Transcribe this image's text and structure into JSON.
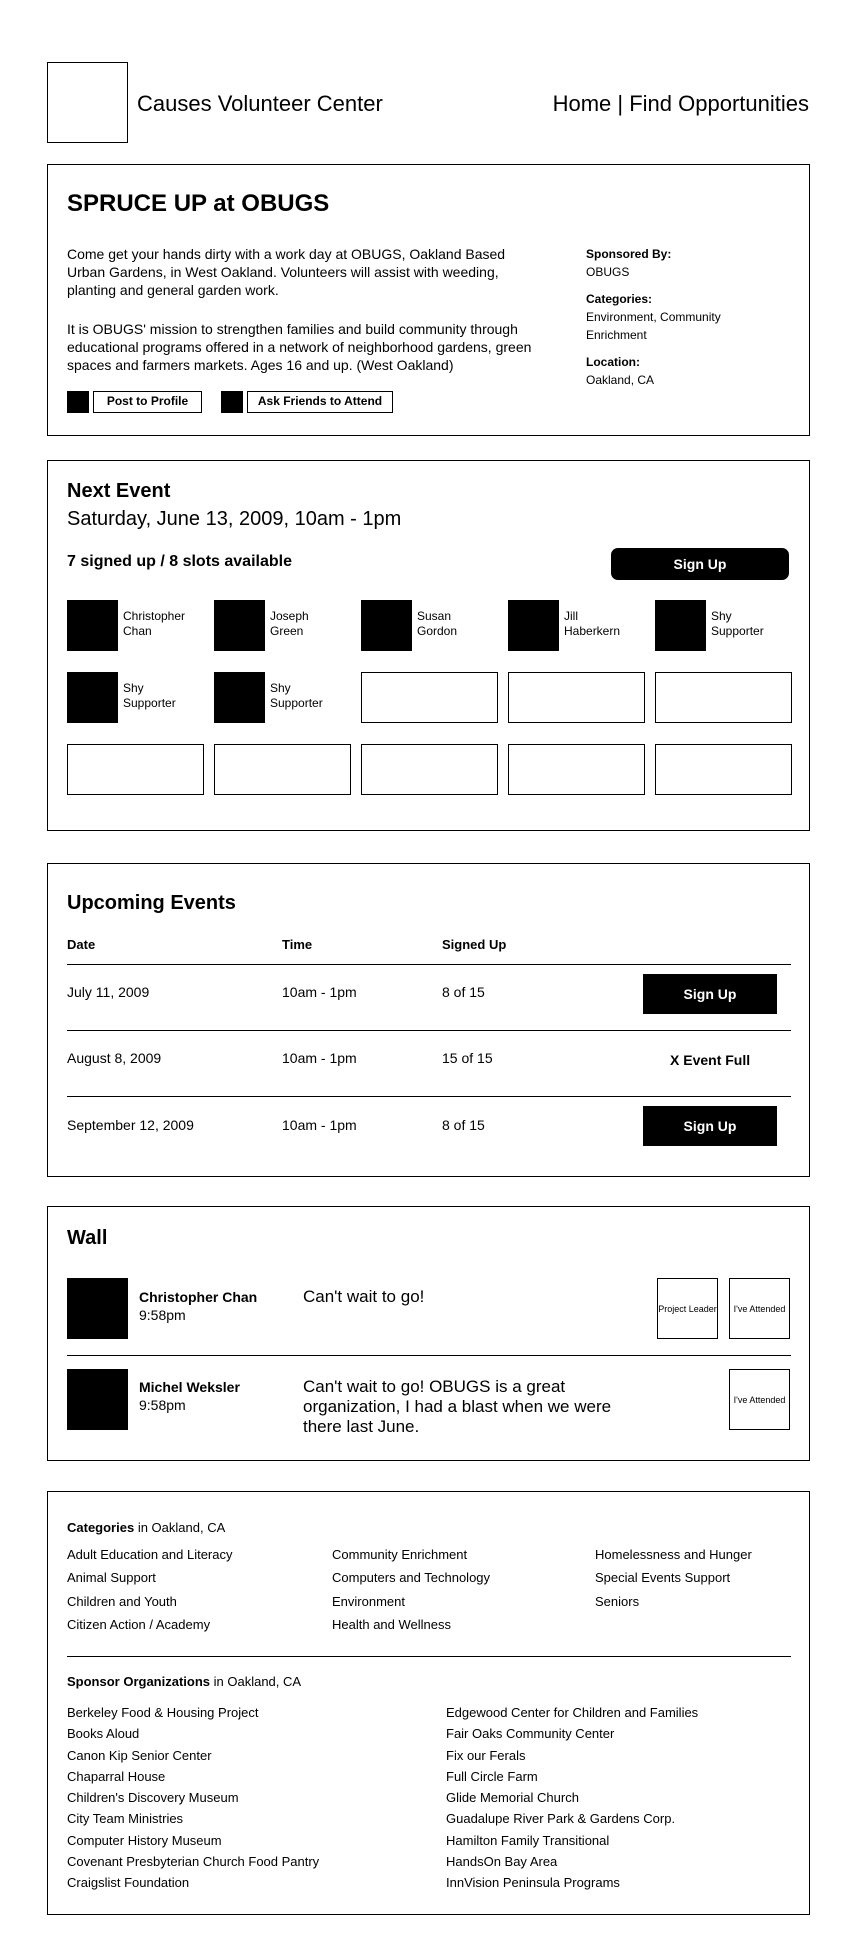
{
  "header": {
    "site_title": "Causes Volunteer Center",
    "nav_home": "Home",
    "nav_sep": "|",
    "nav_find": "Find Opportunities"
  },
  "event": {
    "title": "SPRUCE UP at OBUGS",
    "description_1": "Come get your hands dirty with a work day at OBUGS, Oakland Based Urban Gardens, in West Oakland. Volunteers will assist with weeding, planting and general garden work.",
    "description_2": "It is OBUGS' mission to strengthen families and build community through educational programs offered in a network of neighborhood gardens, green spaces and farmers markets. Ages 16 and up. (West Oakland)",
    "post_button": "Post to Profile",
    "ask_button": "Ask Friends to Attend",
    "sponsored_label": "Sponsored By:",
    "sponsored_value": "OBUGS",
    "categories_label": "Categories:",
    "categories_value": "Environment, Community Enrichment",
    "location_label": "Location:",
    "location_value": "Oakland, CA"
  },
  "next_event": {
    "title": "Next Event",
    "date": "Saturday, June 13, 2009, 10am - 1pm",
    "count": "7 signed up / 8 slots available",
    "signup_button": "Sign Up",
    "slots": [
      {
        "line1": "Christopher",
        "line2": "Chan"
      },
      {
        "line1": "Joseph",
        "line2": "Green"
      },
      {
        "line1": "Susan",
        "line2": "Gordon"
      },
      {
        "line1": "Jill",
        "line2": "Haberkern"
      },
      {
        "line1": "Shy",
        "line2": "Supporter"
      },
      {
        "line1": "Shy",
        "line2": "Supporter"
      },
      {
        "line1": "Shy",
        "line2": "Supporter"
      }
    ]
  },
  "upcoming": {
    "title": "Upcoming Events",
    "col_date": "Date",
    "col_time": "Time",
    "col_signed": "Signed Up",
    "rows": [
      {
        "date": "July 11, 2009",
        "time": "10am - 1pm",
        "signed": "8 of 15",
        "action": "Sign Up"
      },
      {
        "date": "August 8, 2009",
        "time": "10am - 1pm",
        "signed": "15 of 15",
        "action": "X Event Full"
      },
      {
        "date": "September 12, 2009",
        "time": "10am - 1pm",
        "signed": "8 of 15",
        "action": "Sign Up"
      }
    ]
  },
  "wall": {
    "title": "Wall",
    "posts": [
      {
        "name": "Christopher Chan",
        "time": "9:58pm",
        "message": "Can't wait to go!",
        "badge_1": "Project Leader",
        "badge_2": "I've Attended"
      },
      {
        "name": "Michel Weksler",
        "time": "9:58pm",
        "message": "Can't wait to go! OBUGS is a great organization, I had a blast when we were there last June.",
        "badge_2": "I've Attended"
      }
    ]
  },
  "footer": {
    "categories_label": "Categories",
    "categories_suffix": " in Oakland, CA",
    "categories_col1": [
      "Adult Education and Literacy",
      "Animal Support",
      "Children and Youth",
      "Citizen Action / Academy"
    ],
    "categories_col2": [
      "Community Enrichment",
      "Computers and Technology",
      "Environment",
      "Health and Wellness"
    ],
    "categories_col3": [
      "Homelessness and Hunger",
      "Special Events Support",
      "Seniors"
    ],
    "sponsors_label": "Sponsor Organizations",
    "sponsors_suffix": " in Oakland, CA",
    "sponsors_col1": [
      "Berkeley Food & Housing Project",
      "Books Aloud",
      "Canon Kip Senior Center",
      "Chaparral House",
      "Children's Discovery Museum",
      "City Team Ministries",
      "Computer History Museum",
      "Covenant Presbyterian Church Food Pantry",
      "Craigslist Foundation"
    ],
    "sponsors_col2": [
      "Edgewood Center for Children and Families",
      "Fair Oaks Community Center",
      "Fix our Ferals",
      "Full Circle Farm",
      "Glide Memorial Church",
      "Guadalupe River Park & Gardens Corp.",
      "Hamilton Family Transitional",
      "HandsOn Bay Area",
      "InnVision Peninsula Programs"
    ]
  }
}
